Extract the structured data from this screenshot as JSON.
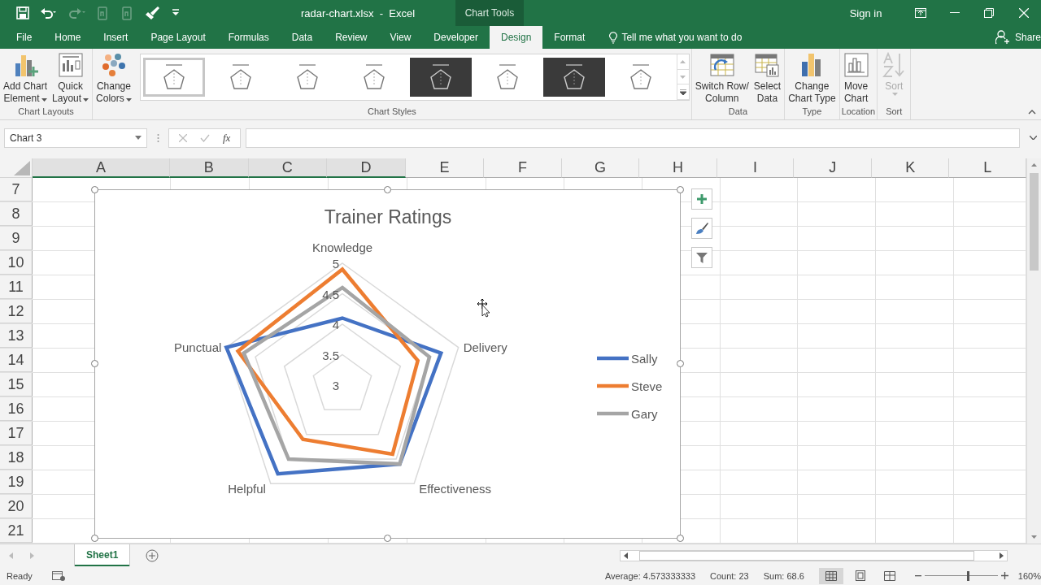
{
  "window": {
    "title": "radar-chart.xlsx  -  Excel",
    "context_label": "Chart Tools",
    "sign_in": "Sign in"
  },
  "quick_access": [
    {
      "kind": "save",
      "disabled": false
    },
    {
      "kind": "undo",
      "disabled": false
    },
    {
      "kind": "redo",
      "disabled": true
    },
    {
      "kind": "device",
      "disabled": true
    },
    {
      "kind": "device",
      "disabled": true
    },
    {
      "kind": "brush",
      "disabled": false
    },
    {
      "kind": "customize",
      "disabled": false
    }
  ],
  "tabs": [
    {
      "label": "File",
      "selected": false
    },
    {
      "label": "Home",
      "selected": false
    },
    {
      "label": "Insert",
      "selected": false
    },
    {
      "label": "Page Layout",
      "selected": false
    },
    {
      "label": "Formulas",
      "selected": false
    },
    {
      "label": "Data",
      "selected": false
    },
    {
      "label": "Review",
      "selected": false
    },
    {
      "label": "View",
      "selected": false
    },
    {
      "label": "Developer",
      "selected": false
    },
    {
      "label": "Design",
      "selected": true
    },
    {
      "label": "Format",
      "selected": false
    }
  ],
  "tell_me": "Tell me what you want to do",
  "share": "Share",
  "ribbon": {
    "groups": [
      {
        "label": "Chart Layouts",
        "buttons": [
          {
            "kind": "add-chart-element",
            "lines": [
              "Add Chart",
              "Element"
            ],
            "dropdown": true,
            "disabled": false
          },
          {
            "kind": "quick-layout",
            "lines": [
              "Quick",
              "Layout"
            ],
            "dropdown": true,
            "disabled": false
          }
        ]
      },
      {
        "label": "Chart Styles",
        "buttons": [
          {
            "kind": "change-colors",
            "lines": [
              "Change",
              "Colors"
            ],
            "dropdown": true,
            "disabled": false
          }
        ],
        "styles": [
          {
            "selected": true,
            "dark": false
          },
          {
            "selected": false,
            "dark": false
          },
          {
            "selected": false,
            "dark": false
          },
          {
            "selected": false,
            "dark": false
          },
          {
            "selected": false,
            "dark": true
          },
          {
            "selected": false,
            "dark": false
          },
          {
            "selected": false,
            "dark": true
          },
          {
            "selected": false,
            "dark": false
          }
        ]
      },
      {
        "label": "Data",
        "buttons": [
          {
            "kind": "switch-row-column",
            "lines": [
              "Switch Row/",
              "Column"
            ],
            "dropdown": false,
            "disabled": false
          },
          {
            "kind": "select-data",
            "lines": [
              "Select",
              "Data"
            ],
            "dropdown": false,
            "disabled": false
          }
        ]
      },
      {
        "label": "Type",
        "buttons": [
          {
            "kind": "change-chart-type",
            "lines": [
              "Change",
              "Chart Type"
            ],
            "dropdown": false,
            "disabled": false
          }
        ]
      },
      {
        "label": "Location",
        "buttons": [
          {
            "kind": "move-chart",
            "lines": [
              "Move",
              "Chart"
            ],
            "dropdown": false,
            "disabled": false
          }
        ]
      },
      {
        "label": "Sort",
        "buttons": [
          {
            "kind": "sort",
            "lines": [
              "Sort"
            ],
            "dropdown": true,
            "disabled": true
          }
        ]
      }
    ]
  },
  "formula_bar": {
    "name_box": "Chart 3",
    "function_label": "fx"
  },
  "sheet": {
    "columns": [
      {
        "label": "A",
        "highlighted": true
      },
      {
        "label": "B",
        "highlighted": true
      },
      {
        "label": "C",
        "highlighted": true
      },
      {
        "label": "D",
        "highlighted": true
      },
      {
        "label": "E",
        "highlighted": false
      },
      {
        "label": "F",
        "highlighted": false
      },
      {
        "label": "G",
        "highlighted": false
      },
      {
        "label": "H",
        "highlighted": false
      },
      {
        "label": "I",
        "highlighted": false
      },
      {
        "label": "J",
        "highlighted": false
      },
      {
        "label": "K",
        "highlighted": false
      },
      {
        "label": "L",
        "highlighted": false
      }
    ],
    "rows": [
      "7",
      "8",
      "9",
      "10",
      "11",
      "12",
      "13",
      "14",
      "15",
      "16",
      "17",
      "18",
      "19",
      "20",
      "21"
    ],
    "tabs": [
      {
        "label": "Sheet1",
        "selected": true
      }
    ]
  },
  "chart": {
    "chart_data": {
      "type": "radar",
      "title": "Trainer Ratings",
      "categories": [
        "Knowledge",
        "Delivery",
        "Effectiveness",
        "Helpful",
        "Punctual"
      ],
      "series": [
        {
          "name": "Sally",
          "color": "#4472c4",
          "values": [
            4.1,
            4.7,
            4.6,
            4.8,
            5
          ]
        },
        {
          "name": "Steve",
          "color": "#ed7d31",
          "values": [
            4.9,
            4.3,
            4.4,
            4.1,
            4.8
          ]
        },
        {
          "name": "Gary",
          "color": "#a5a5a5",
          "values": [
            4.6,
            4.5,
            4.6,
            4.5,
            4.7
          ]
        }
      ],
      "ylim": [
        3,
        5
      ],
      "legend": "right",
      "yticks": [
        3,
        3.5,
        4,
        4.5,
        5
      ]
    }
  },
  "status_bar": {
    "ready": "Ready",
    "average": "Average: 4.573333333",
    "count": "Count: 23",
    "sum": "Sum: 68.6",
    "views": [
      {
        "kind": "normal",
        "selected": true
      },
      {
        "kind": "page-layout",
        "selected": false
      },
      {
        "kind": "page-break",
        "selected": false
      }
    ],
    "zoom": {
      "level": 0.6,
      "reading": "160%"
    }
  }
}
